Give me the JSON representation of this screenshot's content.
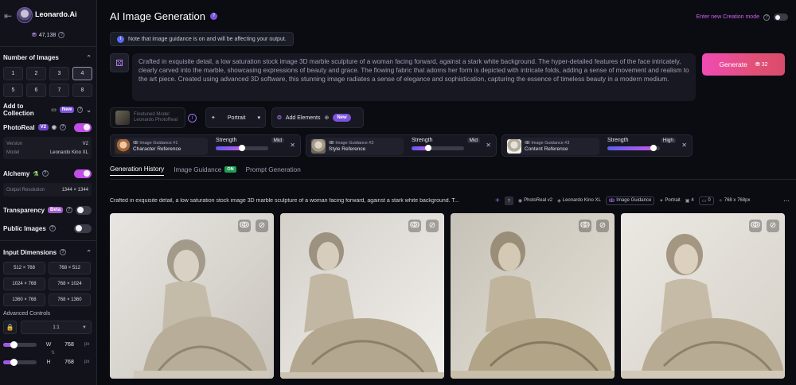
{
  "sidebar": {
    "back_icon": "back-arrow-icon",
    "brand": "Leonardo.Ai",
    "tokens": "47,138",
    "num_images": {
      "title": "Number of Images",
      "options": [
        "1",
        "2",
        "3",
        "4",
        "5",
        "6",
        "7",
        "8"
      ],
      "selected": "4"
    },
    "add_to_collection": {
      "label": "Add to Collection",
      "badge": "New"
    },
    "photoreal": {
      "label": "PhotoReal",
      "badge": "V2",
      "on": true,
      "version_key": "Version",
      "version_val": "V2",
      "model_key": "Model",
      "model_val": "Leonardo Kino XL"
    },
    "alchemy": {
      "label": "Alchemy",
      "on": true,
      "res_key": "Output Resolution",
      "res_val": "1344 × 1344"
    },
    "transparency": {
      "label": "Transparency",
      "badge": "Beta",
      "on": false
    },
    "public_images": {
      "label": "Public Images",
      "on": false
    },
    "input_dimensions": {
      "title": "Input Dimensions",
      "options": [
        "512 × 768",
        "768 × 512",
        "1024 × 768",
        "768 × 1024",
        "1360 × 768",
        "768 × 1360"
      ]
    },
    "advanced": {
      "label": "Advanced Controls",
      "ratio": "1:1",
      "width_label": "W",
      "width_val": "768",
      "height_label": "H",
      "height_val": "768",
      "unit": "px",
      "width_slider_fraction": 0.3,
      "height_slider_fraction": 0.3
    }
  },
  "header": {
    "title": "AI Image Generation",
    "creation_mode": "Enter new Creation mode"
  },
  "notice": "Note that image guidance is on and will be affecting your output.",
  "prompt": "Crafted in exquisite detail, a low saturation stock image 3D marble sculpture of a woman facing forward, against a stark white background. The hyper-detailed features of the face intricately, clearly carved into the marble, showcasing expressions of beauty and grace. The flowing fabric that adorns her form is depicted with intricate folds, adding a sense of movement and realism to the art piece. Created using advanced 3D software, this stunning image radiates a sense of elegance and sophistication, capturing the essence of timeless beauty in a modern medium.",
  "generate": {
    "label": "Generate",
    "cost": "32"
  },
  "options": {
    "preset_line1": "Finetuned Model",
    "preset_line2": "Leonardo PhotoReal",
    "orientation": "Portrait",
    "add_elements": "Add Elements",
    "add_elements_badge": "New"
  },
  "guidance": [
    {
      "small": "Image Guidance #1",
      "name": "Character Reference",
      "strength_label": "Strength",
      "level": "Mid",
      "fraction": 0.5
    },
    {
      "small": "Image Guidance #2",
      "name": "Style Reference",
      "strength_label": "Strength",
      "level": "Mid",
      "fraction": 0.32
    },
    {
      "small": "Image Guidance #3",
      "name": "Content Reference",
      "strength_label": "Strength",
      "level": "High",
      "fraction": 0.88
    }
  ],
  "tabs": [
    {
      "label": "Generation History",
      "active": true
    },
    {
      "label": "Image Guidance",
      "badge": "ON",
      "active": false
    },
    {
      "label": "Prompt Generation",
      "active": false
    }
  ],
  "generation": {
    "prompt_short": "Crafted in exquisite detail, a low saturation stock image 3D marble sculpture of a woman facing forward, against a stark white background. T...",
    "tags": [
      "PhotoReal v2",
      "Leonardo Kino XL",
      "Image Guidance",
      "Portrait",
      "4",
      "0",
      "768 x 768px"
    ]
  },
  "colors": {
    "accent": "#7d53de",
    "toggle_on": "#c14ee6",
    "generate_start": "#f04bb5",
    "generate_end": "#d94b6a"
  }
}
